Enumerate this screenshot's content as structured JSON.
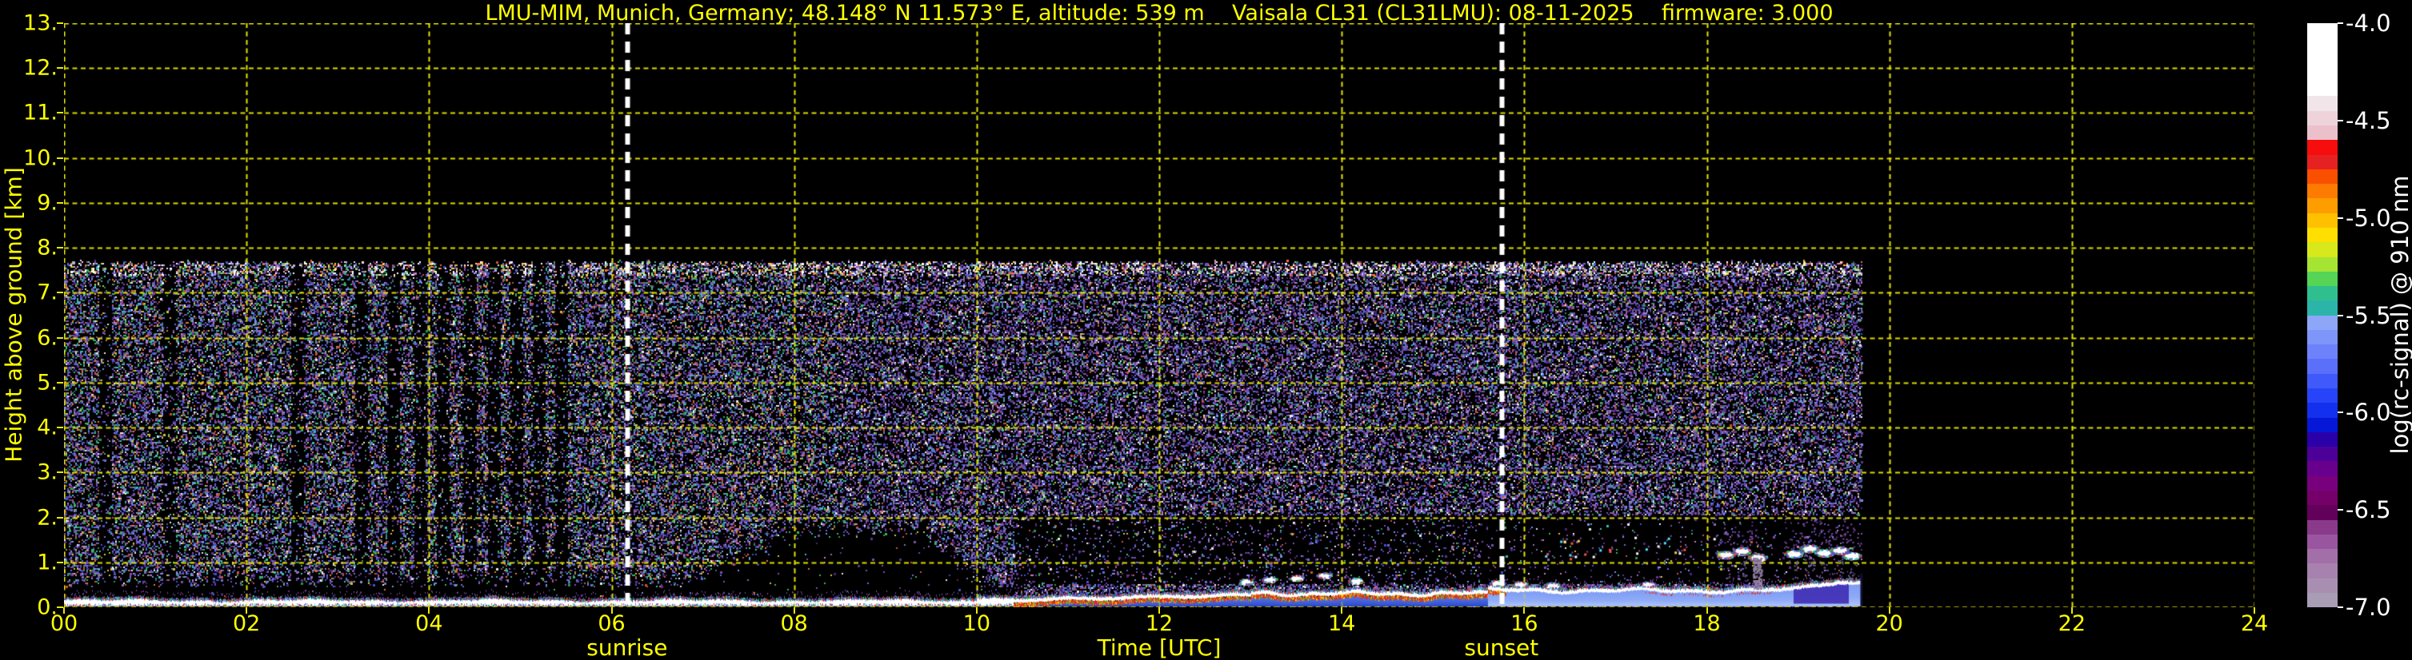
{
  "chart_data": {
    "type": "heatmap",
    "title": "LMU-MIM, Munich, Germany; 48.148° N 11.573° E, altitude: 539 m    Vaisala CL31 (CL31LMU): 08-11-2025    firmware: 3.000",
    "xlabel": "Time [UTC]",
    "ylabel": "Height above ground [km]",
    "colorbar_label": "log(rc-signal) @ 910 nm",
    "xlim": [
      0,
      24
    ],
    "ylim": [
      0,
      13
    ],
    "x_tick_step_hours": 2,
    "x_ticks": [
      "00",
      "02",
      "04",
      "06",
      "08",
      "10",
      "12",
      "14",
      "16",
      "18",
      "20",
      "22",
      "24"
    ],
    "y_ticks": [
      "13.",
      "12.",
      "11.",
      "10.",
      "9.",
      "8.",
      "7.",
      "6.",
      "5.",
      "4.",
      "3.",
      "2.",
      "1.",
      "0."
    ],
    "colorbar_ticks": [
      "-4.0",
      "-4.5",
      "-5.0",
      "-5.5",
      "-6.0",
      "-6.5",
      "-7.0"
    ],
    "colorbar_range": [
      -4.0,
      -7.0
    ],
    "legend_position": "right",
    "grid": {
      "on": true,
      "color": "#e8e800",
      "style": "dashed"
    },
    "text_color": "#ffff00",
    "colorbar_text_color": "#ffffff",
    "background_color": "#000000",
    "annotations": {
      "sunrise_label": "sunrise",
      "sunrise_utc": 6.17,
      "sunset_label": "sunset",
      "sunset_utc": 15.75,
      "line_color": "#ffffff",
      "line_style": "dashed"
    },
    "colorbar_colors_top_to_bottom": [
      "#ffffff",
      "#ffffff",
      "#ffffff",
      "#ffffff",
      "#ffffff",
      "#f1e5e9",
      "#eed3da",
      "#ecc0cb",
      "#f60d0d",
      "#e62121",
      "#fb4f00",
      "#fd7b00",
      "#fe9d00",
      "#ffc000",
      "#fedf00",
      "#d7e81b",
      "#a6e434",
      "#55d455",
      "#2fbf8f",
      "#2ab5a8",
      "#8ea6f8",
      "#7e95fa",
      "#6d82fa",
      "#5a6ffa",
      "#4059fa",
      "#2844f8",
      "#1230ee",
      "#0617d8",
      "#2a00a8",
      "#4c0098",
      "#68008d",
      "#79007d",
      "#75006a",
      "#63005a",
      "#8a3a8a",
      "#9a55a0",
      "#a36fa9",
      "#a782ae",
      "#a88fb1",
      "#a99cb5"
    ],
    "data_coverage": {
      "time_start_utc": 0.0,
      "time_end_utc": 19.7,
      "noise_field_top_km": 7.7,
      "bright_band_bottom_km": 7.4,
      "ground_signal_top_km_night": 0.18,
      "ground_signal_top_km_evening": 0.45
    },
    "features": {
      "attenuation_streaks_utc": [
        0.45,
        1.15,
        2.55,
        3.25,
        3.6,
        3.9,
        4.15,
        4.45,
        4.7,
        4.95,
        5.2,
        5.45
      ],
      "noise_bottom_profile": [
        {
          "t0": 0.0,
          "t1": 6.8,
          "h": 0.85
        },
        {
          "t0": 8.0,
          "t1": 9.4,
          "h": 2.05
        },
        {
          "t0": 10.4,
          "t1": 19.7,
          "h": 0.3
        }
      ],
      "rainbow_layer": {
        "t0": 10.4,
        "t1": 15.8
      },
      "blue_aerosol_layer": {
        "t0": 10.4,
        "t1": 19.7
      },
      "small_clouds": [
        {
          "t": 12.95,
          "h": 0.58
        },
        {
          "t": 13.2,
          "h": 0.63
        },
        {
          "t": 13.5,
          "h": 0.66
        },
        {
          "t": 13.8,
          "h": 0.72
        },
        {
          "t": 14.15,
          "h": 0.6
        },
        {
          "t": 15.7,
          "h": 0.55
        },
        {
          "t": 15.95,
          "h": 0.52
        },
        {
          "t": 16.3,
          "h": 0.5
        },
        {
          "t": 17.35,
          "h": 0.52
        }
      ],
      "high_clouds": [
        {
          "t": 18.2,
          "h": 1.18
        },
        {
          "t": 18.38,
          "h": 1.26
        },
        {
          "t": 18.55,
          "h": 1.12
        },
        {
          "t": 18.95,
          "h": 1.2
        },
        {
          "t": 19.12,
          "h": 1.32
        },
        {
          "t": 19.28,
          "h": 1.22
        },
        {
          "t": 19.45,
          "h": 1.28
        },
        {
          "t": 19.58,
          "h": 1.16
        }
      ],
      "plume": {
        "t": 18.55,
        "h_base": 0.42,
        "h_top": 1.1
      },
      "dark_patch": {
        "t0": 18.95,
        "t1": 19.55,
        "h0": 0.08,
        "h1": 0.55
      },
      "bright_dots_region": {
        "t0": 16.2,
        "t1": 18.2,
        "h0": 1.05,
        "h1": 1.6,
        "count": 26
      }
    }
  }
}
